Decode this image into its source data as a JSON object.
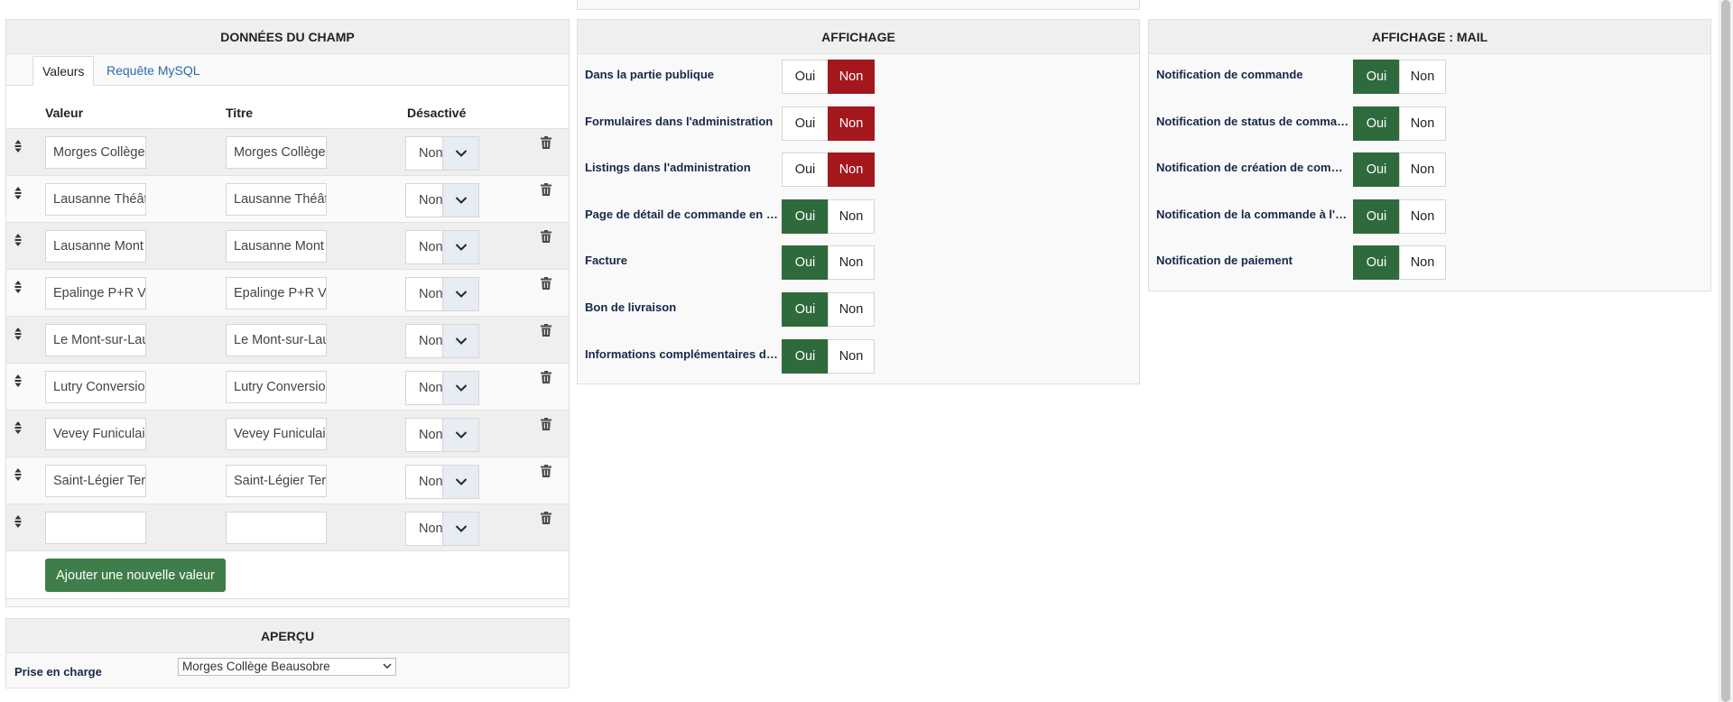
{
  "field_data": {
    "title": "DONNÉES DU CHAMP",
    "tabs": [
      {
        "label": "Valeurs",
        "active": true
      },
      {
        "label": "Requête MySQL",
        "active": false
      }
    ],
    "columns": {
      "value": "Valeur",
      "title": "Titre",
      "disabled": "Désactivé"
    },
    "rows": [
      {
        "value": "Morges Collège",
        "title": "Morges Collège",
        "disabled": "Non"
      },
      {
        "value": "Lausanne Théât",
        "title": "Lausanne Théât",
        "disabled": "Non"
      },
      {
        "value": "Lausanne Mont",
        "title": "Lausanne Mont",
        "disabled": "Non"
      },
      {
        "value": "Epalinge P+R Ve",
        "title": "Epalinge P+R Ve",
        "disabled": "Non"
      },
      {
        "value": "Le Mont-sur-Lau",
        "title": "Le Mont-sur-Lau",
        "disabled": "Non"
      },
      {
        "value": "Lutry Conversio",
        "title": "Lutry Conversio",
        "disabled": "Non"
      },
      {
        "value": "Vevey Funiculai",
        "title": "Vevey Funiculai",
        "disabled": "Non"
      },
      {
        "value": "Saint-Légier Ter",
        "title": "Saint-Légier Ter",
        "disabled": "Non"
      },
      {
        "value": "",
        "title": "",
        "disabled": "Non"
      }
    ],
    "add_button": "Ajouter une nouvelle valeur"
  },
  "preview": {
    "title": "APERÇU",
    "label": "Prise en charge",
    "selected": "Morges Collège Beausobre"
  },
  "display": {
    "title": "AFFICHAGE",
    "options": [
      {
        "label": "Dans la partie publique",
        "value": "Non"
      },
      {
        "label": "Formulaires dans l'administration",
        "value": "Non"
      },
      {
        "label": "Listings dans l'administration",
        "value": "Non"
      },
      {
        "label": "Page de détail de commande en par...",
        "value": "Oui"
      },
      {
        "label": "Facture",
        "value": "Oui"
      },
      {
        "label": "Bon de livraison",
        "value": "Oui"
      },
      {
        "label": "Informations complémentaires de c...",
        "value": "Oui"
      }
    ]
  },
  "display_mail": {
    "title": "AFFICHAGE : MAIL",
    "options": [
      {
        "label": "Notification de commande",
        "value": "Oui"
      },
      {
        "label": "Notification de status de commande",
        "value": "Oui"
      },
      {
        "label": "Notification de création de comman...",
        "value": "Oui"
      },
      {
        "label": "Notification de la commande à l'ad...",
        "value": "Oui"
      },
      {
        "label": "Notification de paiement",
        "value": "Oui"
      }
    ]
  },
  "toggle_labels": {
    "yes": "Oui",
    "no": "Non"
  },
  "colors": {
    "yes_active": "#2f6a3c",
    "no_active": "#a3171d",
    "primary_button": "#3f7d4a",
    "tab_link": "#2c6aa8"
  },
  "icons": {
    "drag": "drag-handle-icon",
    "delete": "trash-icon",
    "dropdown": "chevron-down-icon"
  }
}
